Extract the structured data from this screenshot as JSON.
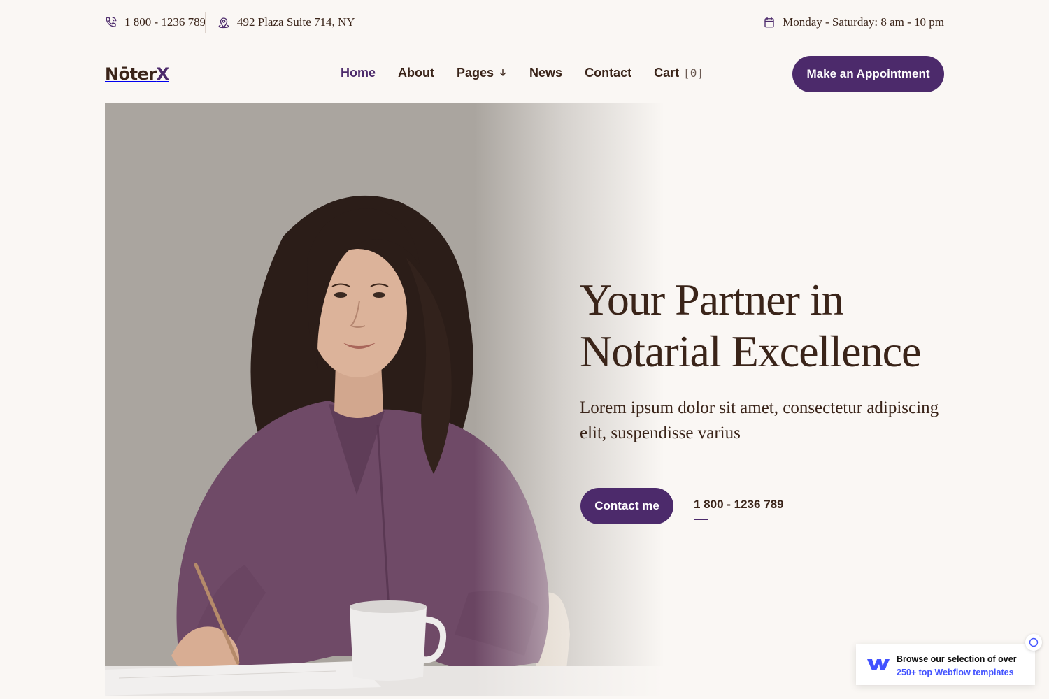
{
  "topbar": {
    "phone": "1 800 - 1236 789",
    "address": "492 Plaza Suite 714, NY",
    "hours": "Monday - Saturday: 8 am - 10 pm"
  },
  "brand": {
    "logo_main": "Nōter",
    "logo_accent": "X"
  },
  "nav": {
    "items": [
      "Home",
      "About",
      "Pages",
      "News",
      "Contact"
    ],
    "cart_label": "Cart",
    "cart_count": "[0]"
  },
  "header_cta": "Make an Appointment",
  "hero": {
    "title": "Your Partner in Notarial Excellence",
    "subtitle": "Lorem ipsum dolor sit amet, consectetur adipiscing elit, suspendisse varius",
    "cta": "Contact me",
    "phone": "1 800 - 1236 789"
  },
  "webflow_badge": {
    "line1": "Browse our selection of over",
    "line2": "250+ top Webflow templates"
  },
  "colors": {
    "accent": "#4c2a6b",
    "text": "#3a2419",
    "background": "#faf7f4",
    "webflow_blue": "#4353ff"
  }
}
